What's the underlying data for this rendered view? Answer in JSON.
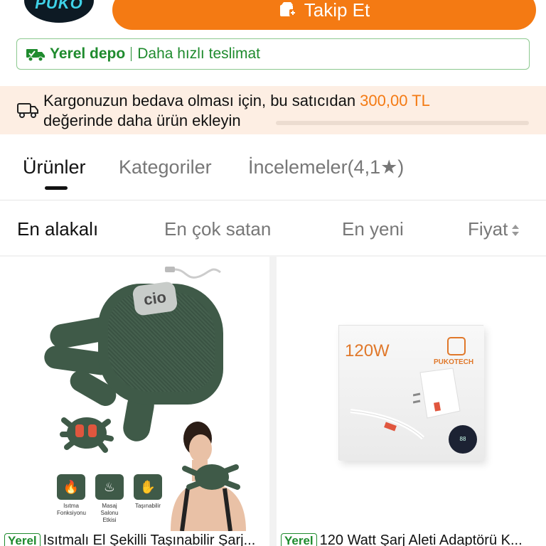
{
  "store": {
    "logo_text": "PUKO",
    "follow_label": "Takip Et"
  },
  "depot": {
    "title": "Yerel depo",
    "subtitle": "Daha hızlı teslimat"
  },
  "promo": {
    "text_before": "Kargonuzun bedava olması için, bu satıcıdan ",
    "amount": "300,00 TL",
    "text_after": "değerinde daha ürün ekleyin",
    "progress": 0
  },
  "tabs": [
    {
      "label": "Ürünler",
      "active": true
    },
    {
      "label": "Kategoriler",
      "active": false
    },
    {
      "label": "İncelemeler(4,1★)",
      "active": false
    }
  ],
  "sort": [
    {
      "label": "En alakalı",
      "active": true
    },
    {
      "label": "En çok satan",
      "active": false
    },
    {
      "label": "En yeni",
      "active": false
    },
    {
      "label": "Fiyat",
      "active": false
    }
  ],
  "products": [
    {
      "badge": "Yerel",
      "title": "Isıtmalı El Şekilli Taşınabilir Şarj...",
      "image_text": {
        "device_logo": "cio",
        "features": [
          "Isıtma Fonksiyonu",
          "Masaj Salonu Etkisi",
          "Taşınabilir"
        ]
      }
    },
    {
      "badge": "Yerel",
      "title": "120 Watt Şarj Aleti Adaptörü K...",
      "image_text": {
        "power": "120W",
        "brand": "PUKOTECH"
      }
    }
  ],
  "colors": {
    "accent": "#f47a13",
    "green": "#1f8b2e",
    "promo_bg": "#fdeee3"
  }
}
